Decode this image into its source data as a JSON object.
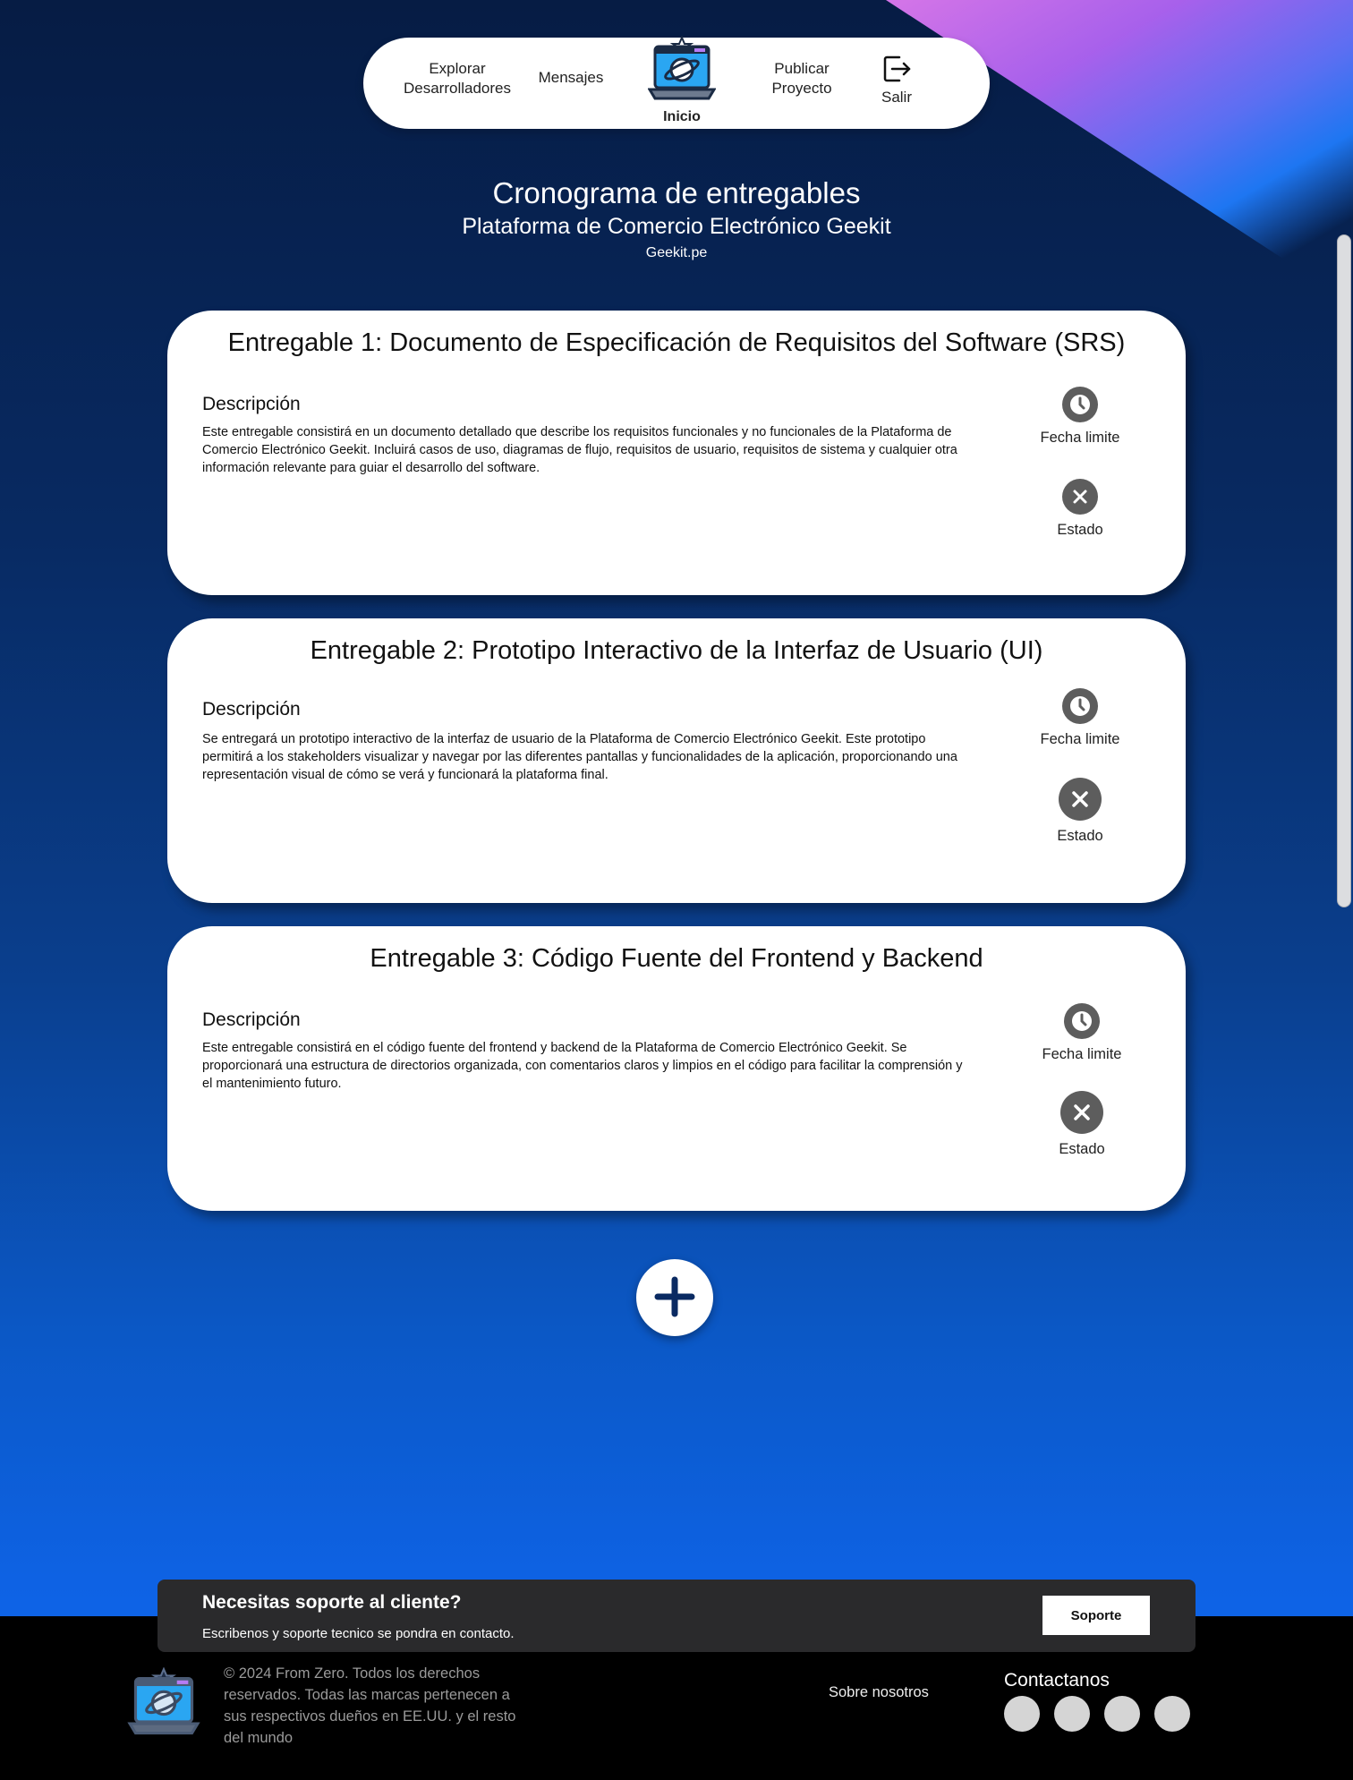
{
  "nav": {
    "explore_line1": "Explorar",
    "explore_line2": "Desarrolladores",
    "messages": "Mensajes",
    "home": "Inicio",
    "publish_line1": "Publicar",
    "publish_line2": "Proyecto",
    "exit": "Salir"
  },
  "header": {
    "title": "Cronograma de entregables",
    "subtitle": "Plataforma de Comercio Electrónico Geekit",
    "site": "Geekit.pe"
  },
  "cards": [
    {
      "title": "Entregable 1: Documento de Especificación de Requisitos del Software (SRS)",
      "desc_heading": "Descripción",
      "desc": "Este entregable consistirá en un documento detallado que describe los requisitos funcionales y no funcionales de la Plataforma de Comercio Electrónico Geekit. Incluirá casos de uso, diagramas de flujo, requisitos de usuario, requisitos de sistema y cualquier otra información relevante para guiar el desarrollo del software.",
      "deadline_label": "Fecha limite",
      "status_label": "Estado"
    },
    {
      "title": "Entregable 2: Prototipo Interactivo de la Interfaz de Usuario (UI)",
      "desc_heading": "Descripción",
      "desc": "Se entregará un prototipo interactivo de la interfaz de usuario de la Plataforma de Comercio Electrónico Geekit. Este prototipo permitirá a los stakeholders visualizar y navegar por las diferentes pantallas y funcionalidades de la aplicación, proporcionando una representación visual de cómo se verá y funcionará la plataforma final.",
      "deadline_label": "Fecha limite",
      "status_label": "Estado"
    },
    {
      "title": "Entregable 3: Código Fuente del Frontend y Backend",
      "desc_heading": "Descripción",
      "desc": "Este entregable consistirá en el código fuente del frontend y backend de la Plataforma de Comercio Electrónico Geekit. Se proporcionará una estructura de directorios organizada, con comentarios claros y limpios en el código para facilitar la comprensión y el mantenimiento futuro.",
      "deadline_label": "Fecha limite",
      "status_label": "Estado"
    }
  ],
  "icons": {
    "deadline": "clock-icon",
    "status": "close-icon",
    "add": "plus-icon",
    "exit": "logout-icon"
  },
  "support": {
    "question": "Necesitas soporte al cliente?",
    "subtitle": "Escribenos y soporte tecnico se pondra en contacto.",
    "button": "Soporte"
  },
  "footer": {
    "copyright": "© 2024 From Zero. Todos los derechos reservados. Todas las marcas pertenecen a sus respectivos dueños en EE.UU. y el resto del mundo",
    "about": "Sobre nosotros",
    "contact": "Contactanos"
  },
  "colors": {
    "accent_dark": "#0a2a62",
    "icon_grey": "#5d5d5d"
  }
}
